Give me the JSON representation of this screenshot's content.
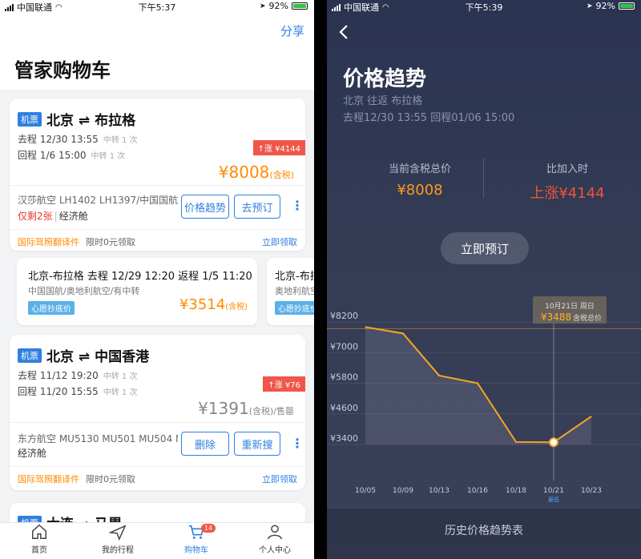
{
  "left": {
    "status": {
      "carrier": "中国联通",
      "time": "下午5:37",
      "battery": "92%"
    },
    "header": {
      "share": "分享",
      "title": "管家购物车"
    },
    "card1": {
      "tag": "机票",
      "route": "北京 ⇌ 布拉格",
      "outbound": "去程 12/30 13:55",
      "outbound_note": "中转 1 次",
      "return": "回程 1/6 15:00",
      "return_note": "中转 1 次",
      "rise": "↑涨 ¥4144",
      "price": "¥8008",
      "price_suffix": "(含税)",
      "airline": "汉莎航空 LH1402 LH1397/中国国航...",
      "remaining": "仅剩2张",
      "sep": "|",
      "cabin": "经济舱",
      "btn_trend": "价格趋势",
      "btn_book": "去预订",
      "promo_orange": "国际驾照翻译件",
      "promo_gray": "限时0元领取",
      "promo_link": "立即领取"
    },
    "subcards": [
      {
        "route": "北京-布拉格  去程 12/29 12:20 返程 1/5 11:20",
        "airline": "中国国航/奥地利航空/有中转",
        "tag": "心愿抄底价",
        "price": "¥3514",
        "price_suffix": "(含税)"
      },
      {
        "route": "北京-布拉",
        "airline": "奥地利航空",
        "tag": "心愿抄底价"
      }
    ],
    "card2": {
      "tag": "机票",
      "route": "北京 ⇌ 中国香港",
      "outbound": "去程 11/12 19:20",
      "outbound_note": "中转 1 次",
      "return": "回程 11/20 15:55",
      "return_note": "中转 1 次",
      "rise": "↑涨 ¥76",
      "price": "¥1391",
      "price_suffix": "(含税)/售罄",
      "airline": "东方航空 MU5130 MU501 MU504 M...",
      "cabin": "经济舱",
      "btn_delete": "删除",
      "btn_research": "重新搜",
      "promo_orange": "国际驾照翻译件",
      "promo_gray": "限时0元领取",
      "promo_link": "立即领取"
    },
    "card3": {
      "tag": "机票",
      "route": "大连 → 马累"
    },
    "tabs": [
      {
        "label": "首页",
        "icon": "home-icon"
      },
      {
        "label": "我的行程",
        "icon": "plane-icon"
      },
      {
        "label": "购物车",
        "icon": "cart-icon",
        "badge": "14",
        "active": true
      },
      {
        "label": "个人中心",
        "icon": "user-icon"
      }
    ]
  },
  "right": {
    "status": {
      "carrier": "中国联通",
      "time": "下午5:39",
      "battery": "92%"
    },
    "title": "价格趋势",
    "route": "北京 往返 布拉格",
    "dates": "去程12/30 13:55  回程01/06 15:00",
    "current_label": "当前含税总价",
    "current_value": "¥8008",
    "compare_label": "比加入时",
    "compare_value": "上涨¥4144",
    "book": "立即预订",
    "history": "历史价格趋势表"
  },
  "chart_data": {
    "type": "line",
    "x": [
      "10/05",
      "10/09",
      "10/13",
      "10/16",
      "10/18",
      "10/21",
      "10/23"
    ],
    "values": [
      8000,
      7750,
      6100,
      5800,
      3500,
      3488,
      4500
    ],
    "y_ticks": [
      "¥8200",
      "¥7000",
      "¥5800",
      "¥4600",
      "¥3400"
    ],
    "ylim": [
      3400,
      8200
    ],
    "grid": true,
    "tooltip": {
      "date": "10月21日 周日",
      "price": "¥3488",
      "suffix": "含税总价"
    },
    "lowest_label": "最低",
    "lowest_index": 5,
    "colors": {
      "line": "#f5a623",
      "area": "rgba(255,255,255,0.10)"
    }
  }
}
